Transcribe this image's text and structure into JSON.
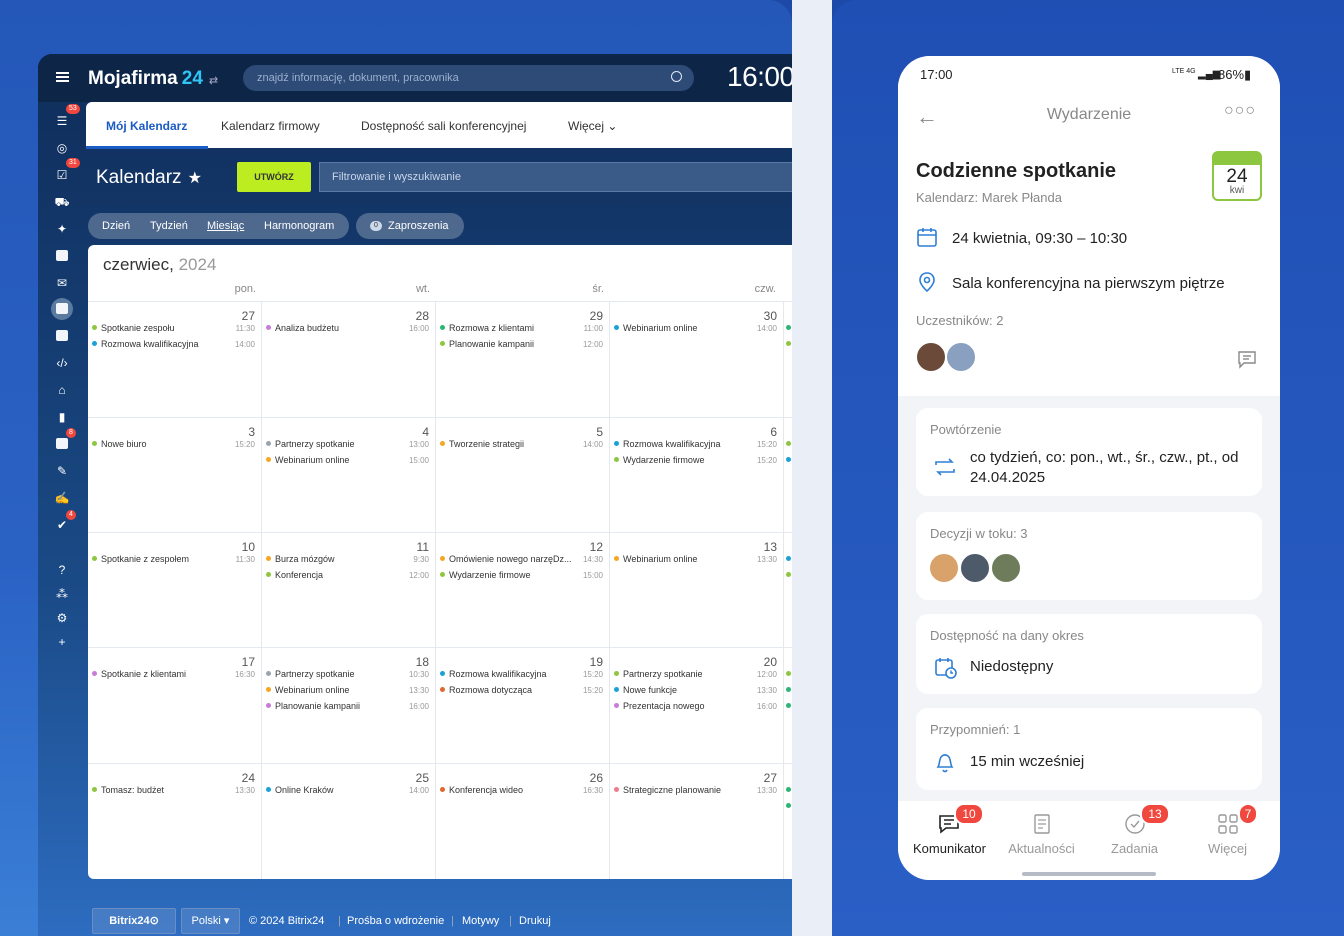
{
  "desktop": {
    "brand": "Mojafirma",
    "brand_num": "24",
    "search_placeholder": "znajdź informację, dokument, pracownika",
    "clock": "16:00",
    "sidebar_badges": [
      "53",
      "31",
      "8",
      "4"
    ],
    "tabs": [
      "Mój Kalendarz",
      "Kalendarz firmowy",
      "Dostępność sali konferencyjnej",
      "Więcej"
    ],
    "title": "Kalendarz",
    "create": "UTWÓRZ",
    "filter_placeholder": "Filtrowanie i wyszukiwanie",
    "views": [
      "Dzień",
      "Tydzień",
      "Miesiąc",
      "Harmonogram"
    ],
    "invites_count": "0",
    "invites": "Zaproszenia",
    "month": "czerwiec,",
    "year": "2024",
    "day_headers": [
      "pon.",
      "wt.",
      "śr.",
      "czw."
    ],
    "weeks": [
      [
        {
          "day": "27",
          "events": [
            {
              "t": "Spotkanie zespołu",
              "time": "11:30",
              "c": "#8dc63f"
            },
            {
              "t": "Rozmowa kwalifikacyjna",
              "time": "14:00",
              "c": "#1ba1d6"
            }
          ]
        },
        {
          "day": "28",
          "events": [
            {
              "t": "Analiza budżetu",
              "time": "16:00",
              "c": "#c77dd8"
            }
          ]
        },
        {
          "day": "29",
          "events": [
            {
              "t": "Rozmowa z klientami",
              "time": "11:00",
              "c": "#2bb673"
            },
            {
              "t": "Planowanie kampanii",
              "time": "12:00",
              "c": "#8dc63f"
            }
          ]
        },
        {
          "day": "30",
          "events": [
            {
              "t": "Webinarium online",
              "time": "14:00",
              "c": "#1ba1d6"
            }
          ]
        }
      ],
      [
        {
          "day": "3",
          "events": [
            {
              "t": "Nowe biuro",
              "time": "15:20",
              "c": "#8dc63f"
            }
          ]
        },
        {
          "day": "4",
          "events": [
            {
              "t": "Partnerzy spotkanie",
              "time": "13:00",
              "c": "#9aa4b0"
            },
            {
              "t": "Webinarium online",
              "time": "15:00",
              "c": "#f5a623"
            }
          ]
        },
        {
          "day": "5",
          "events": [
            {
              "t": "Tworzenie strategii",
              "time": "14:00",
              "c": "#f5a623"
            }
          ]
        },
        {
          "day": "6",
          "events": [
            {
              "t": "Rozmowa kwalifikacyjna",
              "time": "15:20",
              "c": "#1ba1d6"
            },
            {
              "t": "Wydarzenie firmowe",
              "time": "15:20",
              "c": "#8dc63f"
            }
          ]
        }
      ],
      [
        {
          "day": "10",
          "events": [
            {
              "t": "Spotkanie z zespołem",
              "time": "11:30",
              "c": "#8dc63f"
            }
          ]
        },
        {
          "day": "11",
          "events": [
            {
              "t": "Burza mózgów",
              "time": "9:30",
              "c": "#f5a623"
            },
            {
              "t": "Konferencja",
              "time": "12:00",
              "c": "#8dc63f"
            }
          ]
        },
        {
          "day": "12",
          "events": [
            {
              "t": "Omówienie nowego narzęDz...",
              "time": "14:30",
              "c": "#f5a623"
            },
            {
              "t": "Wydarzenie firmowe",
              "time": "15:00",
              "c": "#8dc63f"
            }
          ]
        },
        {
          "day": "13",
          "events": [
            {
              "t": "Webinarium online",
              "time": "13:30",
              "c": "#f5a623"
            }
          ]
        }
      ],
      [
        {
          "day": "17",
          "events": [
            {
              "t": "Spotkanie z klientami",
              "time": "16:30",
              "c": "#c77dd8"
            }
          ]
        },
        {
          "day": "18",
          "events": [
            {
              "t": "Partnerzy spotkanie",
              "time": "10:30",
              "c": "#9aa4b0"
            },
            {
              "t": "Webinarium online",
              "time": "13:30",
              "c": "#f5a623"
            },
            {
              "t": "Planowanie kampanii",
              "time": "16:00",
              "c": "#c77dd8"
            }
          ]
        },
        {
          "day": "19",
          "events": [
            {
              "t": "Rozmowa kwalifikacyjna",
              "time": "15:20",
              "c": "#1ba1d6"
            },
            {
              "t": "Rozmowa dotycząca",
              "time": "15:20",
              "c": "#e0672f"
            }
          ]
        },
        {
          "day": "20",
          "events": [
            {
              "t": "Partnerzy spotkanie",
              "time": "12:00",
              "c": "#8dc63f"
            },
            {
              "t": "Nowe funkcje",
              "time": "13:30",
              "c": "#1ba1d6"
            },
            {
              "t": "Prezentacja nowego",
              "time": "16:00",
              "c": "#c77dd8"
            }
          ]
        }
      ],
      [
        {
          "day": "24",
          "events": [
            {
              "t": "Tomasz: budżet",
              "time": "13:30",
              "c": "#8dc63f"
            }
          ]
        },
        {
          "day": "25",
          "events": [
            {
              "t": "Online Kraków",
              "time": "14:00",
              "c": "#1ba1d6"
            }
          ]
        },
        {
          "day": "26",
          "events": [
            {
              "t": "Konferencja wideo",
              "time": "16:30",
              "c": "#e0672f"
            }
          ]
        },
        {
          "day": "27",
          "events": [
            {
              "t": "Strategiczne planowanie",
              "time": "13:30",
              "c": "#f07a8a"
            }
          ]
        }
      ]
    ],
    "footer": {
      "logo": "Bitrix24",
      "lang": "Polski",
      "copy": "© 2024 Bitrix24",
      "links": [
        "Prośba o wdrożenie",
        "Motywy",
        "Drukuj"
      ]
    }
  },
  "mobile": {
    "time": "17:00",
    "network": "LTE 4G",
    "battery": "86%",
    "nav_title": "Wydarzenie",
    "event_title": "Codzienne spotkanie",
    "calendar": "Kalendarz: Marek Płanda",
    "date_day": "24",
    "date_month": "kwi",
    "when": "24 kwietnia, 09:30 – 10:30",
    "where": "Sala konferencyjna na pierwszym piętrze",
    "participants": "Uczestników: 2",
    "repeat_label": "Powtórzenie",
    "repeat_text_1": "co tydzień, co: pon., wt., śr., czw., pt., od",
    "repeat_text_2": "24.04.2025",
    "decisions": "Decyzji w toku: 3",
    "availability_label": "Dostępność na dany okres",
    "availability": "Niedostępny",
    "reminders_label": "Przypomnień: 1",
    "reminder": "15 min wcześniej",
    "bottom_nav": [
      {
        "label": "Komunikator",
        "badge": "10"
      },
      {
        "label": "Aktualności",
        "badge": ""
      },
      {
        "label": "Zadania",
        "badge": "13"
      },
      {
        "label": "Więcej",
        "badge": "7"
      }
    ]
  }
}
